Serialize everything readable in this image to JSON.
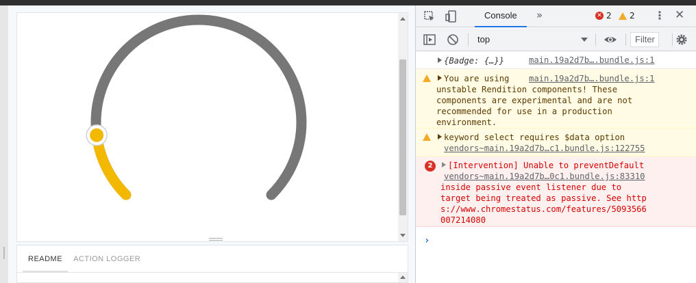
{
  "addons": {
    "tabs": [
      "README",
      "ACTION LOGGER"
    ]
  },
  "devtools": {
    "console_tab": "Console",
    "error_count": "2",
    "warning_count": "2",
    "context": "top",
    "filter_placeholder": "Filter",
    "messages": [
      {
        "level": "log",
        "text": "{Badge: {…}}",
        "source": "main.19a2d7b….bundle.js:1"
      },
      {
        "level": "warning",
        "lines": [
          "You are using",
          "unstable Rendition components! These",
          "components are experimental and are not",
          "recommended for use in a production",
          "environment."
        ],
        "source": "main.19a2d7b….bundle.js:1"
      },
      {
        "level": "warning",
        "text": "keyword select requires $data option",
        "source": "vendors~main.19a2d7b…c1.bundle.js:122755"
      },
      {
        "level": "error",
        "count": "2",
        "text": "[Intervention] Unable to preventDefault",
        "source": "vendors~main.19a2d7b…0c1.bundle.js:83310",
        "lines": [
          "inside passive event listener due to",
          "target being treated as passive. See http",
          "s://www.chromestatus.com/features/5093566",
          "007214080"
        ]
      }
    ]
  },
  "slider": {
    "value_fraction": 0.14,
    "track_color": "#777777",
    "fill_color": "#f3b800"
  }
}
